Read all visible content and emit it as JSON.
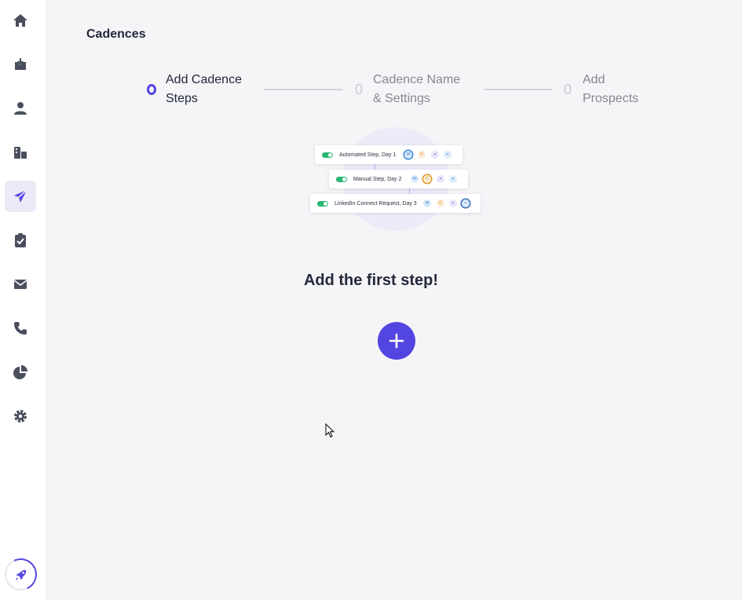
{
  "page": {
    "title": "Cadences"
  },
  "sidebar": {
    "items": [
      {
        "icon": "home-icon"
      },
      {
        "icon": "inbox-icon"
      },
      {
        "icon": "user-icon"
      },
      {
        "icon": "accounts-icon"
      },
      {
        "icon": "send-icon",
        "active": true
      },
      {
        "icon": "clipboard-check-icon"
      },
      {
        "icon": "mail-icon"
      },
      {
        "icon": "phone-icon"
      },
      {
        "icon": "pie-chart-icon"
      },
      {
        "icon": "gear-icon"
      }
    ],
    "bottom_icon": "rocket-icon",
    "accent": "#5346e0"
  },
  "stepper": {
    "steps": [
      {
        "number": "0",
        "label": "Add Cadence\nSteps",
        "active": true
      },
      {
        "number": "0",
        "label": "Cadence Name\n& Settings",
        "active": false
      },
      {
        "number": "0",
        "label": "Add\nProspects",
        "active": false
      }
    ]
  },
  "illustration": {
    "cards": [
      {
        "label": "Automated Step, Day 1"
      },
      {
        "label": "Manual Step, Day 2"
      },
      {
        "label": "LinkedIn Connect Request, Day 3"
      }
    ]
  },
  "empty_state": {
    "heading": "Add the first step!",
    "add_icon": "plus-icon"
  },
  "colors": {
    "primary": "#5346e0",
    "toggle_on": "#2bb673"
  }
}
